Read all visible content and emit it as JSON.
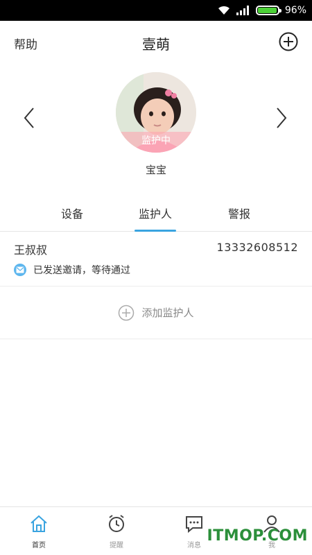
{
  "status_bar": {
    "battery_text": "96%",
    "battery_level": 0.96
  },
  "nav": {
    "help_label": "帮助",
    "title": "壹萌",
    "add_icon": "plus-circle-icon"
  },
  "profile": {
    "status_label": "监护中",
    "name": "宝宝"
  },
  "tabs": [
    {
      "label": "设备",
      "active": false
    },
    {
      "label": "监护人",
      "active": true
    },
    {
      "label": "警报",
      "active": false
    }
  ],
  "guardian": {
    "name": "王叔叔",
    "phone": "13332608512",
    "status": "已发送邀请，等待通过"
  },
  "add_guardian_label": "添加监护人",
  "tabbar": [
    {
      "label": "首页",
      "icon": "home-icon",
      "active": true
    },
    {
      "label": "提醒",
      "icon": "alarm-clock-icon",
      "active": false
    },
    {
      "label": "消息",
      "icon": "message-icon",
      "active": false
    },
    {
      "label": "我",
      "icon": "person-icon",
      "active": false
    }
  ],
  "watermark": "ITMOP.COM",
  "colors": {
    "accent": "#3aa4e0",
    "battery": "#4cd137",
    "watermark": "#2b8f3a"
  }
}
